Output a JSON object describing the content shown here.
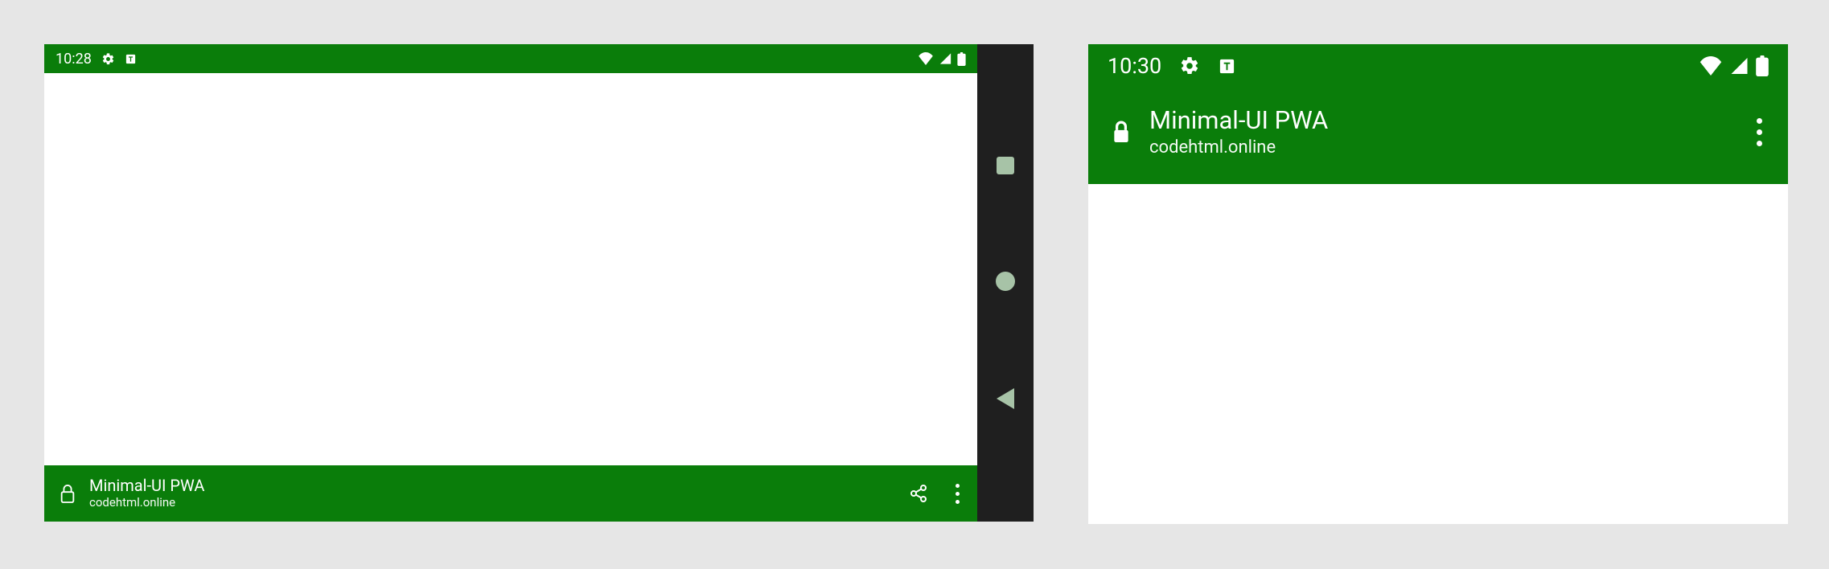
{
  "colors": {
    "theme_green": "#0a7d0a",
    "navbar_dark": "#1f1f1f",
    "nav_icon": "#a7c3a7",
    "page_bg": "#e6e6e6"
  },
  "left_device": {
    "status": {
      "time": "10:28",
      "icons": [
        "gear-icon",
        "text-box-icon"
      ],
      "right_icons": [
        "wifi-icon",
        "cell-signal-icon",
        "battery-icon"
      ]
    },
    "app_bar": {
      "title": "Minimal-UI PWA",
      "domain": "codehtml.online",
      "leading_icon": "lock-icon",
      "actions": [
        "share-icon",
        "more-vertical-icon"
      ]
    },
    "nav_buttons": [
      "overview",
      "home",
      "back"
    ]
  },
  "right_device": {
    "status": {
      "time": "10:30",
      "icons": [
        "gear-icon",
        "text-box-icon"
      ],
      "right_icons": [
        "wifi-icon",
        "cell-signal-icon",
        "battery-icon"
      ]
    },
    "app_bar": {
      "title": "Minimal-UI PWA",
      "domain": "codehtml.online",
      "leading_icon": "lock-icon",
      "actions": [
        "more-vertical-icon"
      ]
    }
  }
}
